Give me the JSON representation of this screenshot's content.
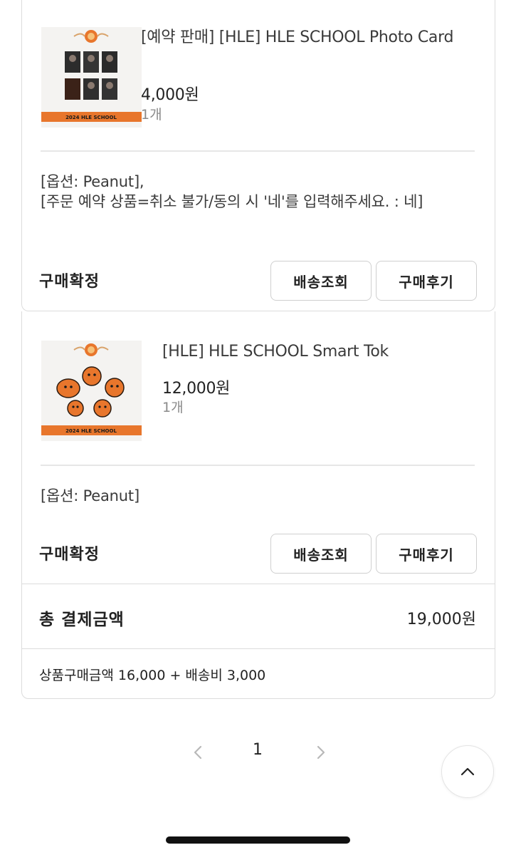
{
  "orders": [
    {
      "title": "[예약 판매] [HLE] HLE SCHOOL Photo Card",
      "price": "4,000원",
      "quantity": "1개",
      "option_line1": "[옵션: Peanut],",
      "option_line2": "[주문 예약 상품=취소 불가/동의 시 '네'를 입력해주세요. : 네]",
      "status": "구매확정",
      "track_button": "배송조회",
      "review_button": "구매후기",
      "thumb_caption": "2024 HLE SCHOOL"
    },
    {
      "title": "[HLE] HLE SCHOOL Smart Tok",
      "price": "12,000원",
      "quantity": "1개",
      "option_line1": "[옵션: Peanut]",
      "status": "구매확정",
      "track_button": "배송조회",
      "review_button": "구매후기",
      "thumb_caption": "2024 HLE SCHOOL"
    }
  ],
  "total": {
    "label": "총 결제금액",
    "value": "19,000원",
    "breakdown": "상품구매금액 16,000 + 배송비 3,000"
  },
  "pagination": {
    "current_page": "1",
    "prev_icon": "chevron-left-icon",
    "next_icon": "chevron-right-icon"
  },
  "scroll_top_icon": "chevron-up-icon",
  "colors": {
    "accent_orange": "#e8762c",
    "border": "#dcdcdc",
    "muted_text": "#8a8a8a"
  }
}
